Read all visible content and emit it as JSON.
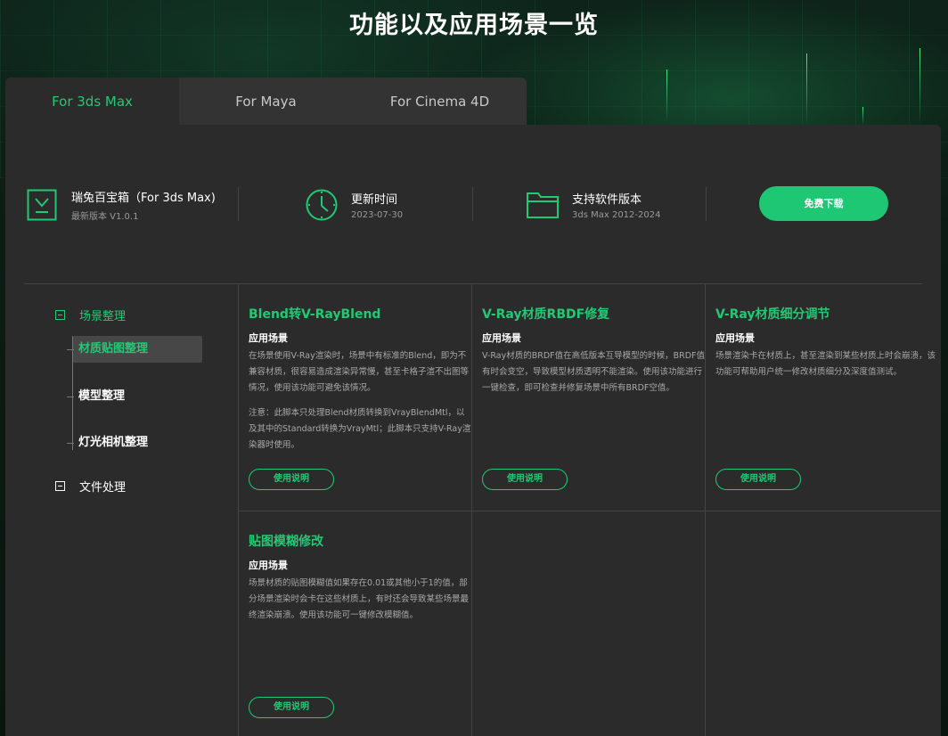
{
  "page_title": "功能以及应用场景一览",
  "tabs": [
    {
      "label": "For 3ds Max",
      "active": true
    },
    {
      "label": "For Maya",
      "active": false
    },
    {
      "label": "For Cinema 4D",
      "active": false
    }
  ],
  "product": {
    "name": "瑞兔百宝箱（For 3ds Max)",
    "version_label": "最新版本  V1.0.1",
    "update_title": "更新时间",
    "update_date": "2023-07-30",
    "support_title": "支持软件版本",
    "support_range": "3ds Max 2012-2024",
    "download_label": "免费下载"
  },
  "sidebar": {
    "categories": [
      {
        "label": "场景整理",
        "expanded": true
      },
      {
        "label": "文件处理",
        "expanded": false
      }
    ],
    "sub_items": [
      {
        "label": "材质贴图整理",
        "active": true
      },
      {
        "label": "模型整理",
        "active": false
      },
      {
        "label": "灯光相机整理",
        "active": false
      }
    ]
  },
  "cards": [
    {
      "title": "Blend转V-RayBlend",
      "label": "应用场景",
      "desc": "在场景使用V-Ray渲染时，场景中有标准的Blend，即为不兼容材质，很容易造成渲染异常慢，甚至卡格子渲不出图等情况，使用该功能可避免该情况。",
      "note": "注意：此脚本只处理Blend材质转换到VrayBlendMtl，以及其中的Standard转换为VrayMtl；此脚本只支持V-Ray渲染器时使用。",
      "button": "使用说明"
    },
    {
      "title": "V-Ray材质RBDF修复",
      "label": "应用场景",
      "desc": "V-Ray材质的BRDF值在高低版本互导模型的时候，BRDF值有时会变空，导致模型材质透明不能渲染。使用该功能进行一键检查，即可检查并修复场景中所有BRDF空值。",
      "button": "使用说明"
    },
    {
      "title": "V-Ray材质细分调节",
      "label": "应用场景",
      "desc": "场景渲染卡在材质上，甚至渲染到某些材质上时会崩溃，该功能可帮助用户统一修改材质细分及深度值测试。",
      "button": "使用说明"
    },
    {
      "title": "贴图模糊修改",
      "label": "应用场景",
      "desc": "场景材质的贴图模糊值如果存在0.01或其他小于1的值，部分场景渲染时会卡在这些材质上，有时还会导致某些场景最终渲染崩溃。使用该功能可一键修改模糊值。",
      "button": "使用说明"
    }
  ],
  "colors": {
    "accent": "#21c974",
    "panel": "#2b2b2b",
    "tab_bar": "#333333"
  }
}
